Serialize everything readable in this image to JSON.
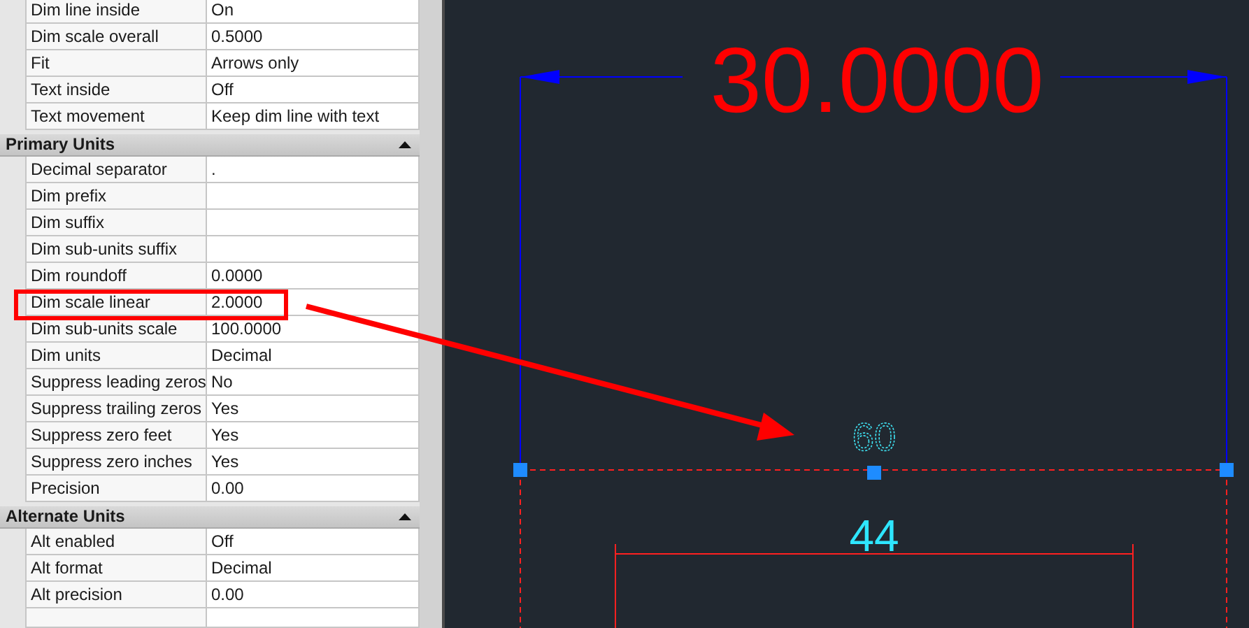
{
  "properties": {
    "sections": [
      {
        "rows": [
          {
            "label": "Dim line inside",
            "value": "On"
          },
          {
            "label": "Dim scale overall",
            "value": "0.5000"
          },
          {
            "label": "Fit",
            "value": "Arrows only"
          },
          {
            "label": "Text inside",
            "value": "Off"
          },
          {
            "label": "Text movement",
            "value": "Keep dim line with text"
          }
        ]
      },
      {
        "title": "Primary Units",
        "expanded": true,
        "rows": [
          {
            "label": "Decimal separator",
            "value": "."
          },
          {
            "label": "Dim prefix"
          },
          {
            "label": "Dim suffix"
          },
          {
            "label": "Dim sub-units suffix"
          },
          {
            "label": "Dim roundoff",
            "value": "0.0000"
          },
          {
            "label": "Dim scale linear",
            "value": "2.0000"
          },
          {
            "label": "Dim sub-units scale",
            "value": "100.0000"
          },
          {
            "label": "Dim units",
            "value": "Decimal"
          },
          {
            "label": "Suppress leading zeros",
            "value": "No"
          },
          {
            "label": "Suppress trailing zeros",
            "value": "Yes"
          },
          {
            "label": "Suppress zero feet",
            "value": "Yes"
          },
          {
            "label": "Suppress zero inches",
            "value": "Yes"
          },
          {
            "label": "Precision",
            "value": "0.00"
          }
        ]
      },
      {
        "title": "Alternate Units",
        "expanded": true,
        "rows": [
          {
            "label": "Alt enabled",
            "value": "Off"
          },
          {
            "label": "Alt format",
            "value": "Decimal"
          },
          {
            "label": "Alt precision",
            "value": "0.00"
          },
          {}
        ]
      }
    ]
  },
  "drawing": {
    "overall_dimension": "30.0000",
    "selected_dimension": "60",
    "inner_dimension": "44"
  }
}
